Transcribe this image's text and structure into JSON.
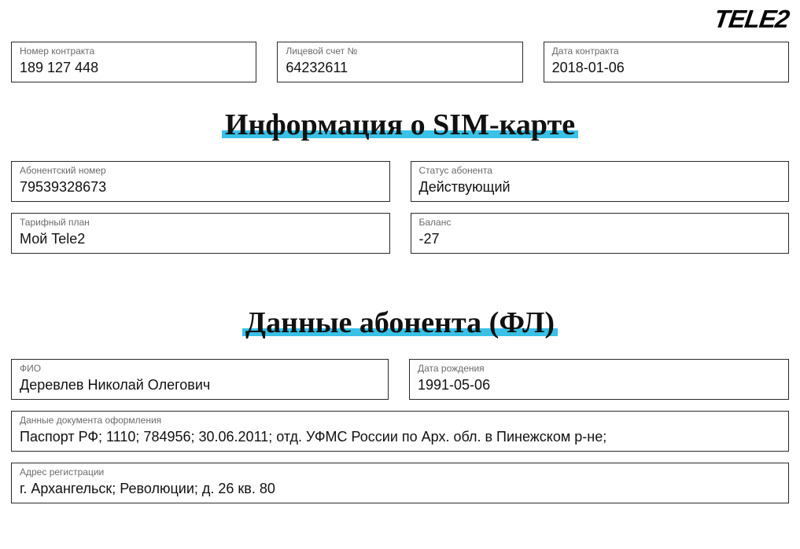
{
  "logo_text": "TELE2",
  "top": {
    "contract_number": {
      "label": "Номер контракта",
      "value": "189 127 448"
    },
    "account": {
      "label": "Лицевой счет №",
      "value": "64232611"
    },
    "contract_date": {
      "label": "Дата контракта",
      "value": "2018-01-06"
    }
  },
  "sim_section_title": "Информация о SIM-карте",
  "sim": {
    "subscriber_number": {
      "label": "Абонентский номер",
      "value": "79539328673"
    },
    "status": {
      "label": "Статус абонента",
      "value": "Действующий"
    },
    "tariff": {
      "label": "Тарифный план",
      "value": "Мой Tele2"
    },
    "balance": {
      "label": "Баланс",
      "value": "-27"
    }
  },
  "subscriber_section_title": "Данные абонента (ФЛ)",
  "subscriber": {
    "fio": {
      "label": "ФИО",
      "value": "Деревлев Николай Олегович"
    },
    "dob": {
      "label": "Дата рождения",
      "value": "1991-05-06"
    },
    "document": {
      "label": "Данные документа оформления",
      "value": "Паспорт РФ; 1110; 784956; 30.06.2011; отд. УФМС России по Арх. обл. в Пинежском р-не;"
    },
    "address": {
      "label": "Адрес регистрации",
      "value": "г. Архангельск; Революции; д. 26 кв. 80"
    }
  }
}
